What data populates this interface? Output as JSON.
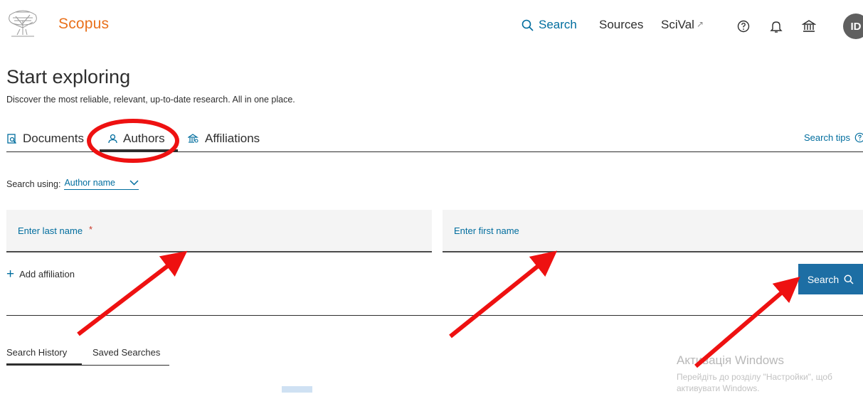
{
  "header": {
    "brand": "Scopus",
    "nav": {
      "search": "Search",
      "sources": "Sources",
      "scival": "SciVal",
      "scival_ext": "↗"
    },
    "avatar_initials": "ID"
  },
  "hero": {
    "title": "Start exploring",
    "subtitle": "Discover the most reliable, relevant, up-to-date research. All in one place."
  },
  "tabs": {
    "documents": "Documents",
    "authors": "Authors",
    "affiliations": "Affiliations",
    "active": "Authors"
  },
  "search_tips": "Search tips",
  "search_using": {
    "label": "Search using:",
    "value": "Author name"
  },
  "fields": {
    "last_name_placeholder": "Enter last name",
    "required_mark": "*",
    "first_name_placeholder": "Enter first name"
  },
  "add_affiliation": "Add affiliation",
  "search_button": "Search",
  "history_tabs": {
    "history": "Search History",
    "saved": "Saved Searches"
  },
  "watermark": {
    "title": "Активація Windows",
    "line1": "Перейдіть до розділу \"Настройки\", щоб",
    "line2": "активувати Windows."
  },
  "colors": {
    "brand": "#e9711c",
    "link": "#006d9e",
    "button": "#1d6ea4",
    "annotation": "#ee1111"
  },
  "icons": {
    "logo": "elsevier-tree-logo",
    "search": "search-icon",
    "help": "help-circle-icon",
    "bell": "bell-icon",
    "institution": "institution-icon"
  }
}
